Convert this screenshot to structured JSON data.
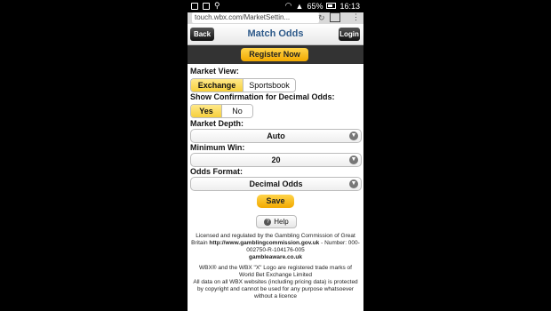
{
  "status_bar": {
    "battery": "65%",
    "time": "16:13"
  },
  "browser": {
    "url": "touch.wbx.com/MarketSettin..."
  },
  "header": {
    "back_label": "Back",
    "title": "Match Odds",
    "login_label": "Login"
  },
  "register": {
    "label": "Register Now"
  },
  "market_view": {
    "label": "Market View:",
    "options": [
      "Exchange",
      "Sportsbook"
    ],
    "selected": "Exchange"
  },
  "confirmation": {
    "label": "Show Confirmation for Decimal Odds:",
    "options": [
      "Yes",
      "No"
    ],
    "selected": "Yes"
  },
  "market_depth": {
    "label": "Market Depth:",
    "value": "Auto"
  },
  "minimum_win": {
    "label": "Minimum Win:",
    "value": "20"
  },
  "odds_format": {
    "label": "Odds Format:",
    "value": "Decimal Odds"
  },
  "save_label": "Save",
  "help_label": "Help",
  "footer": {
    "license_text": "Licensed and regulated by the Gambling Commission of Great Britain",
    "license_url": "http://www.gamblingcommission.gov.uk",
    "number_text": "- Number: 000-002750-R-104176-005",
    "gambleaware": "gambleaware.co.uk",
    "trademark": "WBX® and the WBX \"X\" Logo are registered trade marks of World Bet Exchange Limited",
    "copyright": "All data on all WBX websites (including pricing data) is protected by copyright and cannot be used for any purpose whatsoever without a licence"
  }
}
